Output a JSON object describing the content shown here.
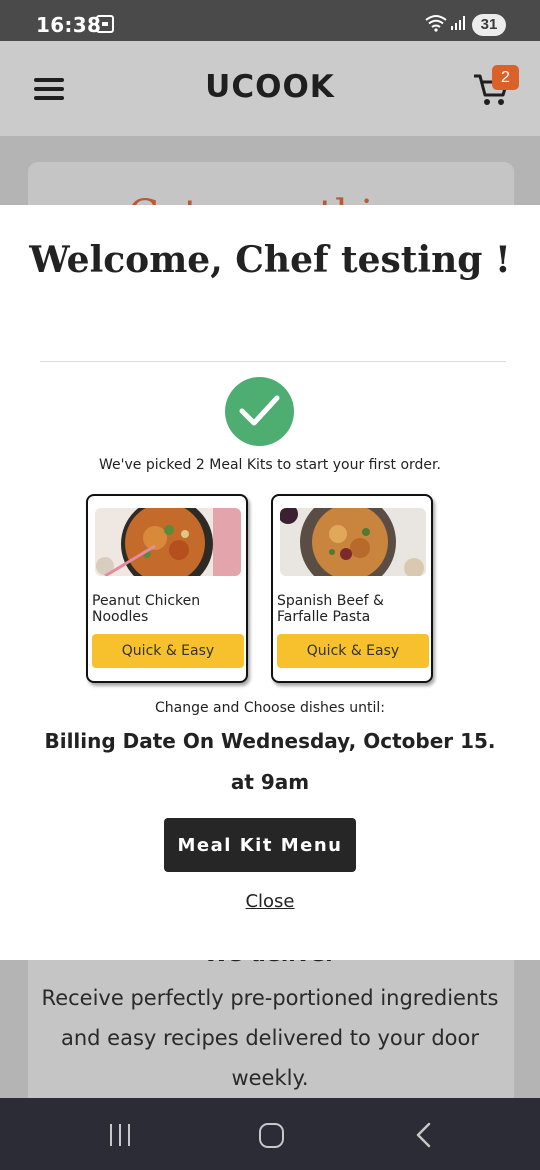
{
  "status_bar": {
    "time": "16:38",
    "battery": "31"
  },
  "header": {
    "logo_text": "ᑌCOOK",
    "cart_count": "2"
  },
  "background": {
    "heading_peek": "Get something",
    "section_heading": "We deliver",
    "body": "Receive perfectly pre-portioned ingredients and easy recipes delivered to your door weekly."
  },
  "modal": {
    "title": "Welcome, Chef testing !",
    "picked_text": "We've picked 2 Meal Kits to start your first order.",
    "meals": [
      {
        "name": "Peanut Chicken Noodles",
        "tag": "Quick & Easy"
      },
      {
        "name": "Spanish Beef & Farfalle Pasta",
        "tag": "Quick & Easy"
      }
    ],
    "change_text": "Change and Choose dishes until:",
    "billing_text": "Billing Date On Wednesday, October 15.",
    "time_text": "at 9am",
    "menu_button": "Meal Kit Menu",
    "close_link": "Close"
  },
  "colors": {
    "accent_orange": "#d9622b",
    "check_green": "#4ead71",
    "tag_yellow": "#f7c12e",
    "button_dark": "#262626"
  }
}
